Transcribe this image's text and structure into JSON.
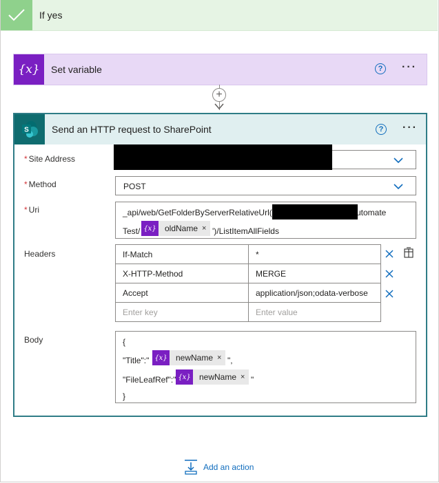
{
  "condition": {
    "title": "If yes"
  },
  "set_variable": {
    "title": "Set variable",
    "help": "?",
    "more": "···"
  },
  "connector": {
    "plus": "+"
  },
  "http_action": {
    "title": "Send an HTTP request to SharePoint",
    "help": "?",
    "more": "···",
    "site_address": {
      "label": "Site Address",
      "required_mark": "*"
    },
    "method": {
      "label": "Method",
      "required_mark": "*",
      "value": "POST"
    },
    "uri": {
      "label": "Uri",
      "required_mark": "*",
      "line1_prefix": "_api/web/GetFolderByServerRelativeUrl('",
      "line1_suffix": "utomate",
      "line2_prefix": "Test/",
      "token": {
        "icon": "{x}",
        "label": "oldName",
        "remove": "×"
      },
      "line2_suffix": "')/ListItemAllFields"
    },
    "headers": {
      "label": "Headers",
      "rows": [
        {
          "key": "If-Match",
          "value": "*"
        },
        {
          "key": "X-HTTP-Method",
          "value": "MERGE"
        },
        {
          "key": "Accept",
          "value": "application/json;odata-verbose"
        }
      ],
      "key_placeholder": "Enter key",
      "value_placeholder": "Enter value"
    },
    "body": {
      "label": "Body",
      "open_brace": "{",
      "line1_prefix": "\"Title\":\"",
      "line1_token": {
        "icon": "{x}",
        "label": "newName",
        "remove": "×"
      },
      "line1_suffix": "\",",
      "line2_prefix": "\"FileLeafRef\":\"",
      "line2_token": {
        "icon": "{x}",
        "label": "newName",
        "remove": "×"
      },
      "line2_suffix": "\"",
      "close_brace": "}"
    }
  },
  "add_action": {
    "label": "Add an action"
  },
  "colors": {
    "success_green": "#8fd18c",
    "variable_purple": "#7a1fc2",
    "sharepoint_teal": "#0f6c6f",
    "link_blue": "#0f6cbd"
  }
}
